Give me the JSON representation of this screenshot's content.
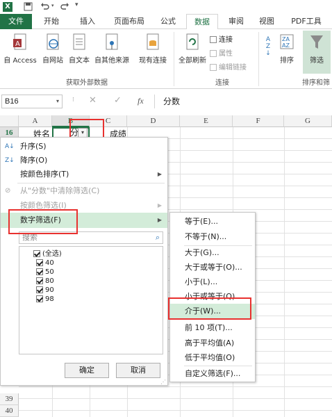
{
  "tabs": {
    "file": "文件",
    "items": [
      "开始",
      "插入",
      "页面布局",
      "公式",
      "数据",
      "审阅",
      "视图",
      "PDF工具"
    ]
  },
  "ribbon": {
    "get_external": {
      "access": "自 Access",
      "web": "自网站",
      "text": "自文本",
      "other": "自其他来源",
      "existing": "现有连接",
      "group": "获取外部数据"
    },
    "connections": {
      "refresh_all": "全部刷新",
      "connections": "连接",
      "properties": "属性",
      "edit_links": "编辑链接",
      "group": "连接"
    },
    "sort_filter": {
      "sort": "排序",
      "filter": "筛选",
      "group": "排序和筛"
    }
  },
  "formula_bar": {
    "name_box": "B16",
    "fx": "fx",
    "value": "分数"
  },
  "grid": {
    "columns": [
      "A",
      "B",
      "C",
      "D",
      "E",
      "F",
      "G"
    ],
    "row_16": "16",
    "cell_a16": "姓名",
    "cell_b16": "分",
    "cell_c16": "成绩",
    "rows_bottom": [
      "39",
      "40"
    ]
  },
  "filter_menu": {
    "sort_asc": "升序(S)",
    "sort_desc": "降序(O)",
    "sort_color": "按颜色排序(T)",
    "clear_filter": "从\"分数\"中清除筛选(C)",
    "filter_color": "按颜色筛选(I)",
    "number_filters": "数字筛选(F)",
    "search_placeholder": "搜索",
    "select_all": "(全选)",
    "values": [
      "40",
      "50",
      "80",
      "90",
      "98"
    ],
    "ok": "确定",
    "cancel": "取消"
  },
  "number_submenu": {
    "items": [
      "等于(E)...",
      "不等于(N)...",
      "大于(G)...",
      "大于或等于(O)...",
      "小于(L)...",
      "小于或等于(Q)...",
      "介于(W)...",
      "前 10 项(T)...",
      "高于平均值(A)",
      "低于平均值(O)",
      "自定义筛选(F)..."
    ]
  },
  "colors": {
    "excel_green": "#217346",
    "highlight": "#d3ecd9",
    "annotation_red": "#e8312f"
  }
}
